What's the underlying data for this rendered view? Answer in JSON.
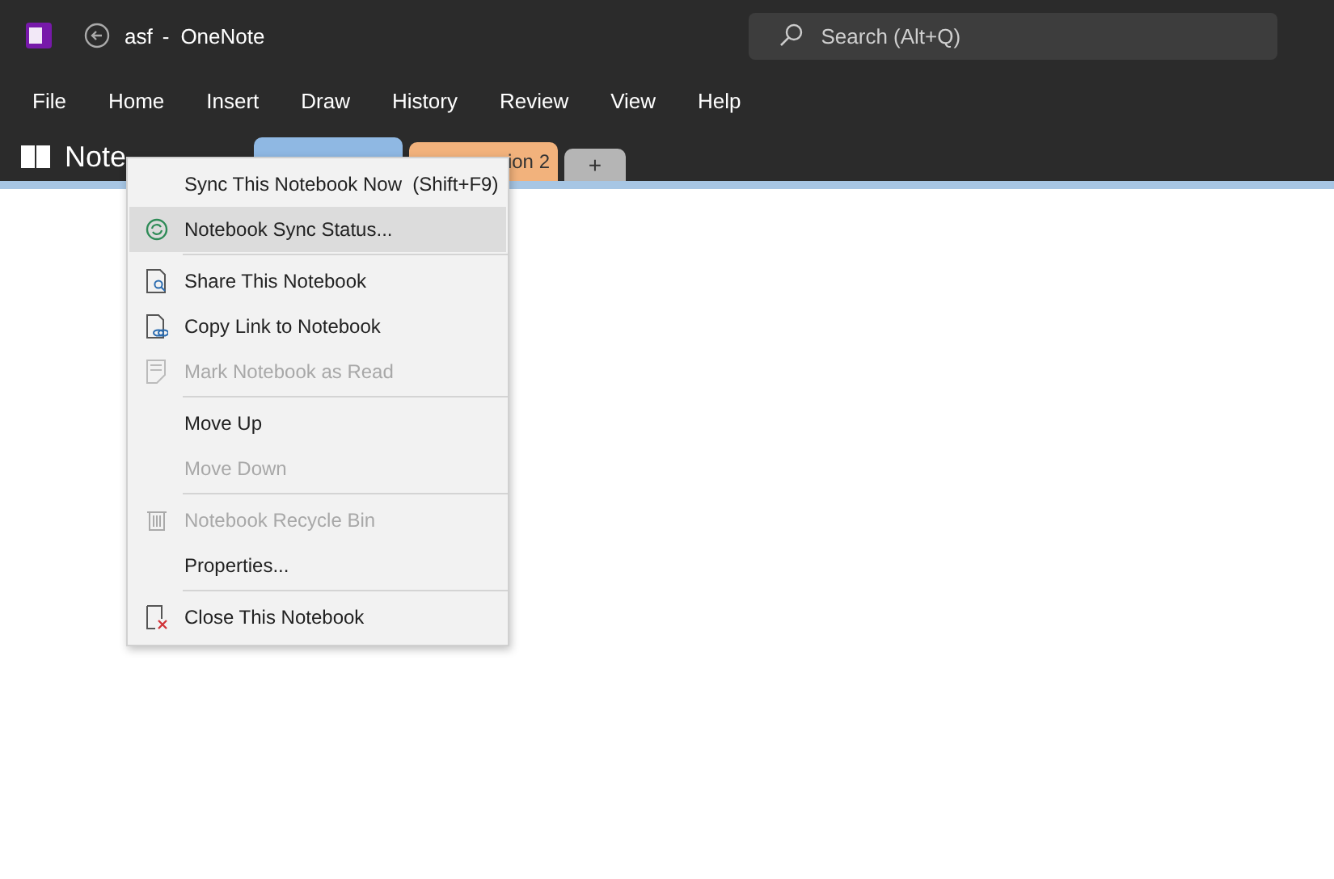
{
  "titlebar": {
    "document": "asf",
    "separator": "-",
    "app": "OneNote",
    "search": {
      "placeholder": "Search (Alt+Q)"
    }
  },
  "menu_bar": [
    {
      "label": "File"
    },
    {
      "label": "Home"
    },
    {
      "label": "Insert"
    },
    {
      "label": "Draw"
    },
    {
      "label": "History"
    },
    {
      "label": "Review"
    },
    {
      "label": "View"
    },
    {
      "label": "Help"
    }
  ],
  "notebook": {
    "name": "Note",
    "tabs": [
      {
        "color": "#8fb8e3",
        "selected": true
      },
      {
        "label": "ion 2",
        "color": "#f2b27c",
        "selected": false
      },
      {
        "label": "+",
        "color": "#b5b5b5",
        "selected": false
      }
    ]
  },
  "context_menu": [
    {
      "kind": "item",
      "label": "Sync This Notebook Now",
      "shortcut": "(Shift+F9)",
      "disabled": false,
      "selected": false
    },
    {
      "kind": "item",
      "label": "Notebook Sync Status...",
      "disabled": false,
      "selected": true
    },
    {
      "kind": "separator"
    },
    {
      "kind": "item",
      "label": "Share This Notebook",
      "disabled": false,
      "selected": false
    },
    {
      "kind": "item",
      "label": "Copy Link to Notebook",
      "disabled": false,
      "selected": false
    },
    {
      "kind": "item",
      "label": "Mark Notebook as Read",
      "disabled": true,
      "selected": false
    },
    {
      "kind": "separator"
    },
    {
      "kind": "item",
      "label": "Move Up",
      "disabled": false,
      "selected": false
    },
    {
      "kind": "item",
      "label": "Move Down",
      "disabled": true,
      "selected": false
    },
    {
      "kind": "separator"
    },
    {
      "kind": "item",
      "label": "Notebook Recycle Bin",
      "disabled": true,
      "selected": false
    },
    {
      "kind": "item",
      "label": "Properties...",
      "disabled": false,
      "selected": false
    },
    {
      "kind": "separator"
    },
    {
      "kind": "item",
      "label": "Close This Notebook",
      "disabled": false,
      "selected": false
    }
  ]
}
